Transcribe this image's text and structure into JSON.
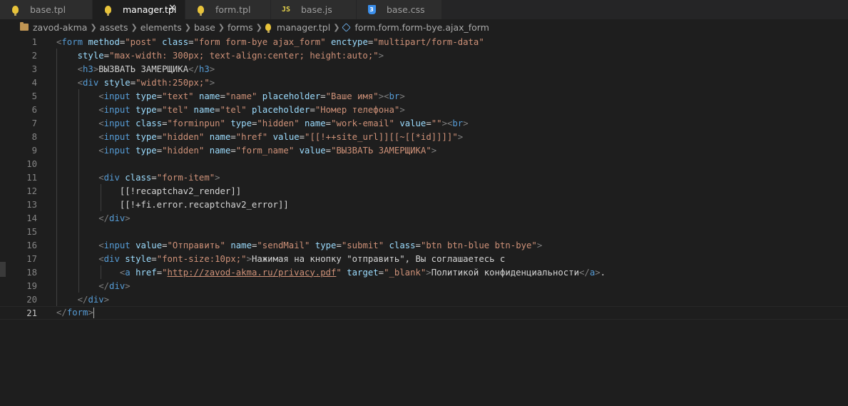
{
  "tabs": [
    {
      "label": "base.tpl",
      "icon": "lightbulb-icon",
      "active": false
    },
    {
      "label": "manager.tpl",
      "icon": "lightbulb-icon",
      "active": true,
      "close": "✕"
    },
    {
      "label": "form.tpl",
      "icon": "lightbulb-icon",
      "active": false
    },
    {
      "label": "base.js",
      "icon": "js-file-icon",
      "badge": "JS",
      "active": false
    },
    {
      "label": "base.css",
      "icon": "css-file-icon",
      "badge": "3",
      "active": false
    }
  ],
  "breadcrumb": [
    "zavod-akma",
    "assets",
    "elements",
    "base",
    "forms",
    "manager.tpl",
    "form.form.form-bye.ajax_form"
  ],
  "line_numbers": [
    "1",
    "2",
    "3",
    "4",
    "5",
    "6",
    "7",
    "8",
    "9",
    "10",
    "11",
    "12",
    "13",
    "14",
    "15",
    "16",
    "17",
    "18",
    "19",
    "20",
    "21"
  ],
  "current_line": 21,
  "code": {
    "l1": {
      "t1": "form",
      "a1": "method",
      "v1": "\"post\"",
      "a2": "class",
      "v2": "\"form form-bye ajax_form\"",
      "a3": "enctype",
      "v3": "\"multipart/form-data\""
    },
    "l2": {
      "a1": "style",
      "v1": "\"max-width: 300px; text-align:center; height:auto;\""
    },
    "l3": {
      "t1": "h3",
      "text": "ВЫЗВАТЬ ЗАМЕРЩИКА",
      "t2": "h3"
    },
    "l4": {
      "t1": "div",
      "a1": "style",
      "v1": "\"width:250px;\""
    },
    "l5": {
      "t1": "input",
      "a1": "type",
      "v1": "\"text\"",
      "a2": "name",
      "v2": "\"name\"",
      "a3": "placeholder",
      "v3": "\"Ваше имя\"",
      "t2": "br"
    },
    "l6": {
      "t1": "input",
      "a1": "type",
      "v1": "\"tel\"",
      "a2": "name",
      "v2": "\"tel\"",
      "a3": "placeholder",
      "v3": "\"Номер телефона\""
    },
    "l7": {
      "t1": "input",
      "a1": "class",
      "v1": "\"forminpun\"",
      "a2": "type",
      "v2": "\"hidden\"",
      "a3": "name",
      "v3": "\"work-email\"",
      "a4": "value",
      "v4": "\"\"",
      "t2": "br"
    },
    "l8": {
      "t1": "input",
      "a1": "type",
      "v1": "\"hidden\"",
      "a2": "name",
      "v2": "\"href\"",
      "a3": "value",
      "v3": "\"[[!++site_url]][[~[[*id]]]]\""
    },
    "l9": {
      "t1": "input",
      "a1": "type",
      "v1": "\"hidden\"",
      "a2": "name",
      "v2": "\"form_name\"",
      "a3": "value",
      "v3": "\"ВЫЗВАТЬ ЗАМЕРЩИКА\""
    },
    "l11": {
      "t1": "div",
      "a1": "class",
      "v1": "\"form-item\""
    },
    "l12": {
      "text": "[[!recaptchav2_render]]"
    },
    "l13": {
      "text": "[[!+fi.error.recaptchav2_error]]"
    },
    "l14": {
      "t1": "div"
    },
    "l16": {
      "t1": "input",
      "a1": "value",
      "v1": "\"Отправить\"",
      "a2": "name",
      "v2": "\"sendMail\"",
      "a3": "type",
      "v3": "\"submit\"",
      "a4": "class",
      "v4": "\"btn btn-blue btn-bye\""
    },
    "l17": {
      "t1": "div",
      "a1": "style",
      "v1": "\"font-size:10px;\"",
      "text": "Нажимая на кнопку \"отправить\", Вы соглашаетесь с"
    },
    "l18": {
      "t1": "a",
      "a1": "href",
      "v1": "http://zavod-akma.ru/privacy.pdf",
      "a2": "target",
      "v2": "\"_blank\"",
      "text": "Политикой конфиденциальности",
      "t2": "a",
      "tail": "."
    },
    "l19": {
      "t1": "div"
    },
    "l20": {
      "t1": "div"
    },
    "l21": {
      "t1": "form"
    }
  },
  "colors": {
    "tag": "#569cd6",
    "attribute": "#9cdcfe",
    "string": "#ce9178",
    "text": "#d4d4d4",
    "background": "#1e1e1e"
  }
}
